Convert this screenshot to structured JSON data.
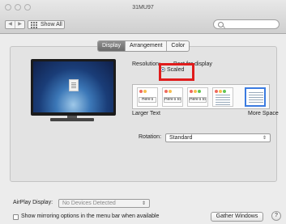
{
  "window": {
    "title": "31MU97"
  },
  "toolbar": {
    "back_glyph": "◀",
    "forward_glyph": "▶",
    "show_all_label": "Show All",
    "search_placeholder": ""
  },
  "tabs": [
    {
      "label": "Display",
      "active": true
    },
    {
      "label": "Arrangement",
      "active": false
    },
    {
      "label": "Color",
      "active": false
    }
  ],
  "display": {
    "resolution_label": "Resolution:",
    "best_for_display_label": "Best for display",
    "scaled_label": "Scaled",
    "selected_option": "Scaled",
    "scale_options": [
      {
        "text": "Here's",
        "selected": false
      },
      {
        "text": "Here's to troublem",
        "selected": false
      },
      {
        "text": "Here's to the crazy ones",
        "selected": false
      },
      {
        "text": "",
        "selected": false
      },
      {
        "text": "",
        "selected": true
      }
    ],
    "larger_text_label": "Larger Text",
    "more_space_label": "More Space",
    "rotation_label": "Rotation:",
    "rotation_value": "Standard",
    "popup_arrow_glyph": "⇕"
  },
  "airplay": {
    "label": "AirPlay Display:",
    "value": "No Devices Detected",
    "popup_arrow_glyph": "⇕"
  },
  "footer": {
    "mirroring_label": "Show mirroring options in the menu bar when available",
    "mirroring_checked": false,
    "gather_windows_label": "Gather Windows",
    "help_label": "?"
  },
  "colors": {
    "highlight_box": "#e01c1c",
    "selected_thumb": "#3b7be0",
    "active_tab": "#7a7a7a"
  }
}
